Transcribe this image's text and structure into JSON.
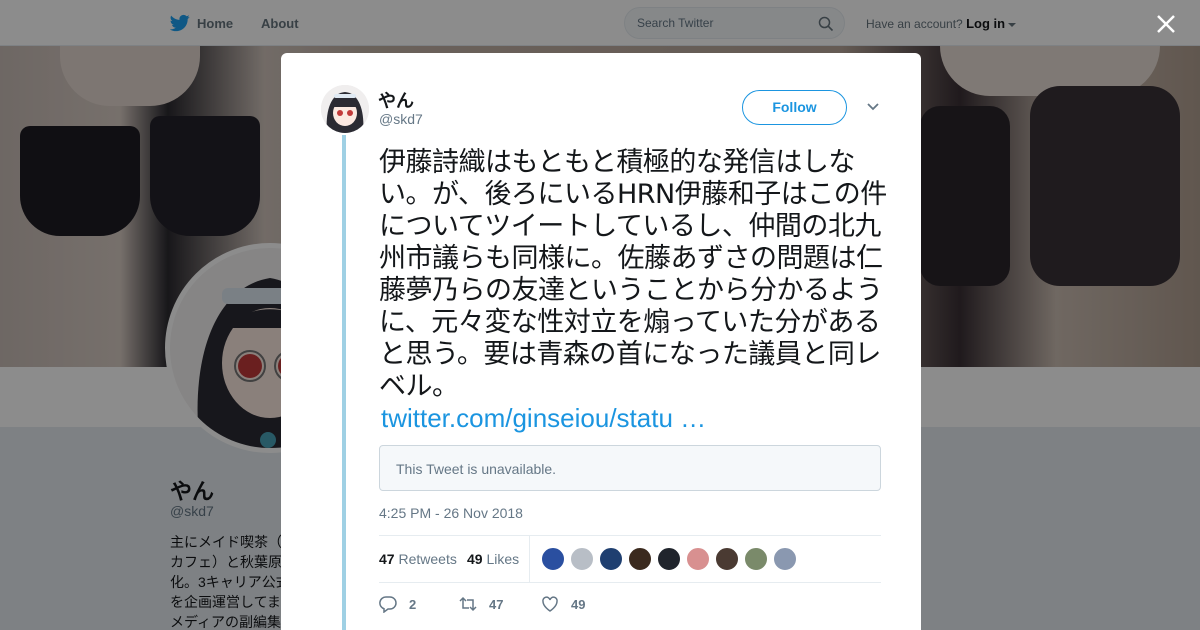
{
  "topnav": {
    "home_label": "Home",
    "about_label": "About",
    "search_placeholder": "Search Twitter",
    "account_prompt": "Have an account?",
    "login_label": "Log in"
  },
  "profile": {
    "name": "やん",
    "handle": "@skd7",
    "bio": "主にメイド喫茶（\nカフェ）と秋葉原\n化。3キャリア公式\nを企画運営してま\nメディアの副編集"
  },
  "tweet": {
    "author_name": "やん",
    "author_handle": "@skd7",
    "follow_label": "Follow",
    "text": "伊藤詩織はもともと積極的な発信はしない。が、後ろにいるHRN伊藤和子はこの件についてツイートしているし、仲間の北九州市議らも同様に。佐藤あずさの問題は仁藤夢乃らの友達ということから分かるように、元々変な性対立を煽っていた分があると思う。要は青森の首になった議員と同レベル。",
    "link": "twitter.com/ginseiou/statu …",
    "quote_text": "This Tweet is unavailable.",
    "timestamp": "4:25 PM - 26 Nov 2018",
    "retweets_count": "47",
    "retweets_label": "Retweets",
    "likes_count": "49",
    "likes_label": "Likes",
    "reply_count": "2",
    "retweet_action_count": "47",
    "like_action_count": "49"
  },
  "likers": [
    {
      "color": "#2a4fa0"
    },
    {
      "color": "#b8bec6"
    },
    {
      "color": "#1f3f70"
    },
    {
      "color": "#3b2a1e"
    },
    {
      "color": "#20242c"
    },
    {
      "color": "#d89090"
    },
    {
      "color": "#4a3a32"
    },
    {
      "color": "#7a8a6a"
    },
    {
      "color": "#8a98b0"
    }
  ],
  "colors": {
    "accent": "#1b95e0",
    "thread_line": "#9fd0e4",
    "text": "#14171a",
    "secondary": "#657786"
  }
}
